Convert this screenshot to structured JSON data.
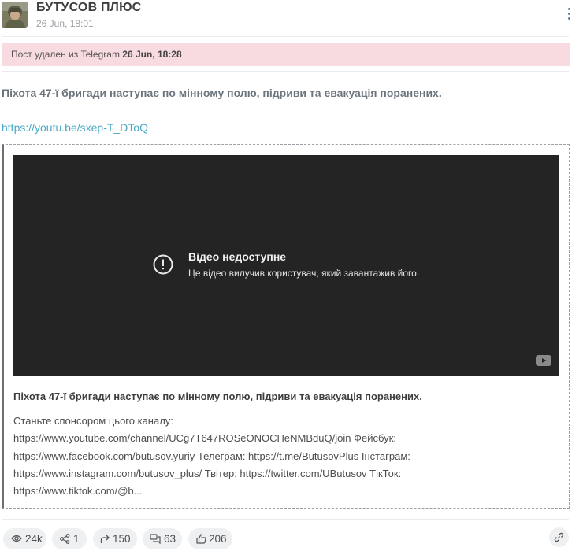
{
  "header": {
    "channel_name": "БУТУСОВ ПЛЮС",
    "date": "26 Jun, 18:01"
  },
  "notice": {
    "text": "Пост удален из Telegram ",
    "date": "26 Jun, 18:28"
  },
  "post": {
    "title": "Піхота 47-ї бригади наступає по мінному полю, підриви та евакуація поранених.",
    "link": "https://youtu.be/sxep-T_DToQ"
  },
  "preview": {
    "video_title": "Відео недоступне",
    "video_subtitle": "Це відео вилучив користувач, який завантажив його",
    "title": "Піхота 47-ї бригади наступає по мінному полю, підриви та евакуація поранених.",
    "description_lines": [
      "Станьте спонсором цього каналу:",
      "https://www.youtube.com/channel/UCg7T647ROSeONOCHeNMBduQ/join Фейсбук:",
      "https://www.facebook.com/butusov.yuriy Телеграм: https://t.me/ButusovPlus Інстаграм:",
      "https://www.instagram.com/butusov_plus/ Твітер: https://twitter.com/UButusov ТікТок:",
      "https://www.tiktok.com/@b..."
    ]
  },
  "stats": {
    "views": "24k",
    "shares": "1",
    "forwards": "150",
    "comments": "63",
    "reactions": "206"
  },
  "icons": {
    "views": "eye-icon",
    "shares": "share-icon",
    "forwards": "forward-icon",
    "comments": "comments-icon",
    "reactions": "thumbs-up-icon",
    "copy_link": "link-icon",
    "menu": "kebab-menu-icon",
    "video_error": "alert-circle-icon"
  },
  "colors": {
    "notice_background": "#f8dbe0",
    "link": "#49a9c4",
    "video_background": "#242424",
    "pill_background": "#eef0f2",
    "menu_dots": "#5e7fa7"
  }
}
